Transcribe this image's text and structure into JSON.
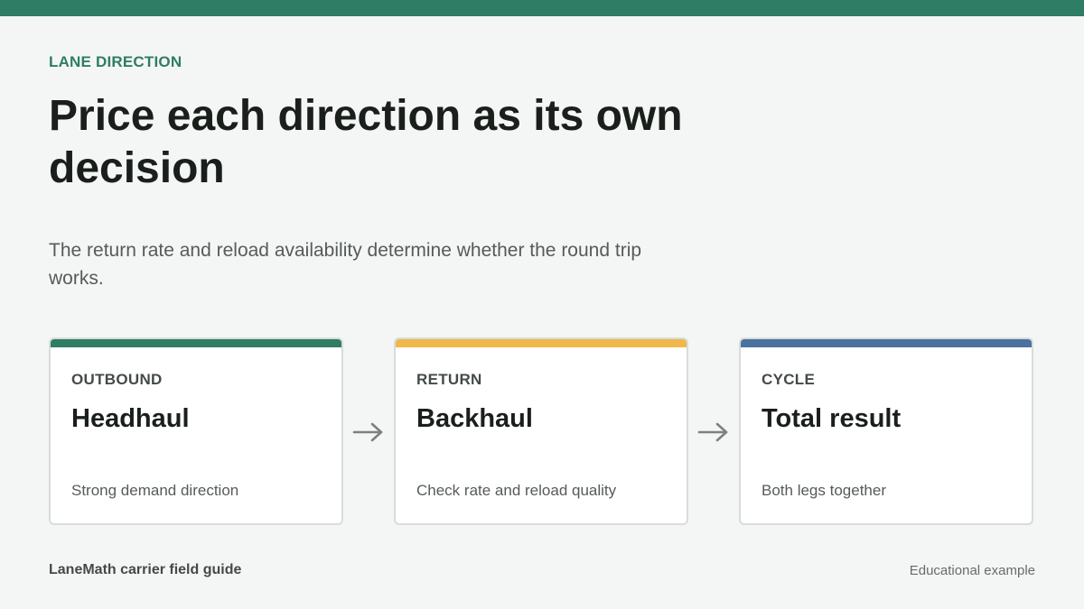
{
  "eyebrow": "LANE DIRECTION",
  "title": "Price each direction as its own decision",
  "subtitle": "The return rate and reload availability determine whether the round trip works.",
  "cards": [
    {
      "label": "OUTBOUND",
      "heading": "Headhaul",
      "description": "Strong demand direction",
      "accent_color": "#2e7d64"
    },
    {
      "label": "RETURN",
      "heading": "Backhaul",
      "description": "Check rate and reload quality",
      "accent_color": "#f0b84a"
    },
    {
      "label": "CYCLE",
      "heading": "Total result",
      "description": "Both legs together",
      "accent_color": "#4a72a0"
    }
  ],
  "footer": {
    "brand": "LaneMath carrier field guide",
    "note": "Educational example"
  },
  "colors": {
    "brand_green": "#2e7d64",
    "arrow": "#7a827e"
  },
  "icons": {
    "connector": "arrow-right-icon"
  }
}
